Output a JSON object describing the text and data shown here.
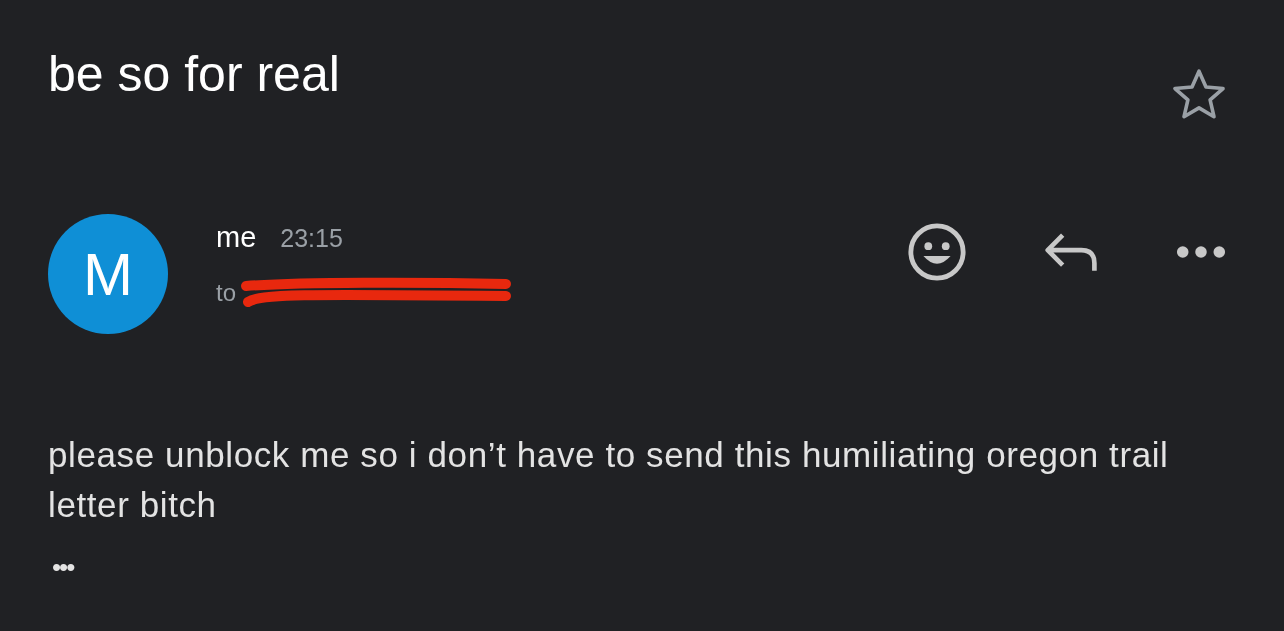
{
  "subject": "be so for real",
  "starred": false,
  "message": {
    "avatar_letter": "M",
    "sender": "me",
    "time": "23:15",
    "recipient_prefix": "to",
    "recipient_redacted": true,
    "body": "please unblock me so i don’t have to send this humiliating oregon trail letter bitch",
    "more_label": "•••"
  }
}
